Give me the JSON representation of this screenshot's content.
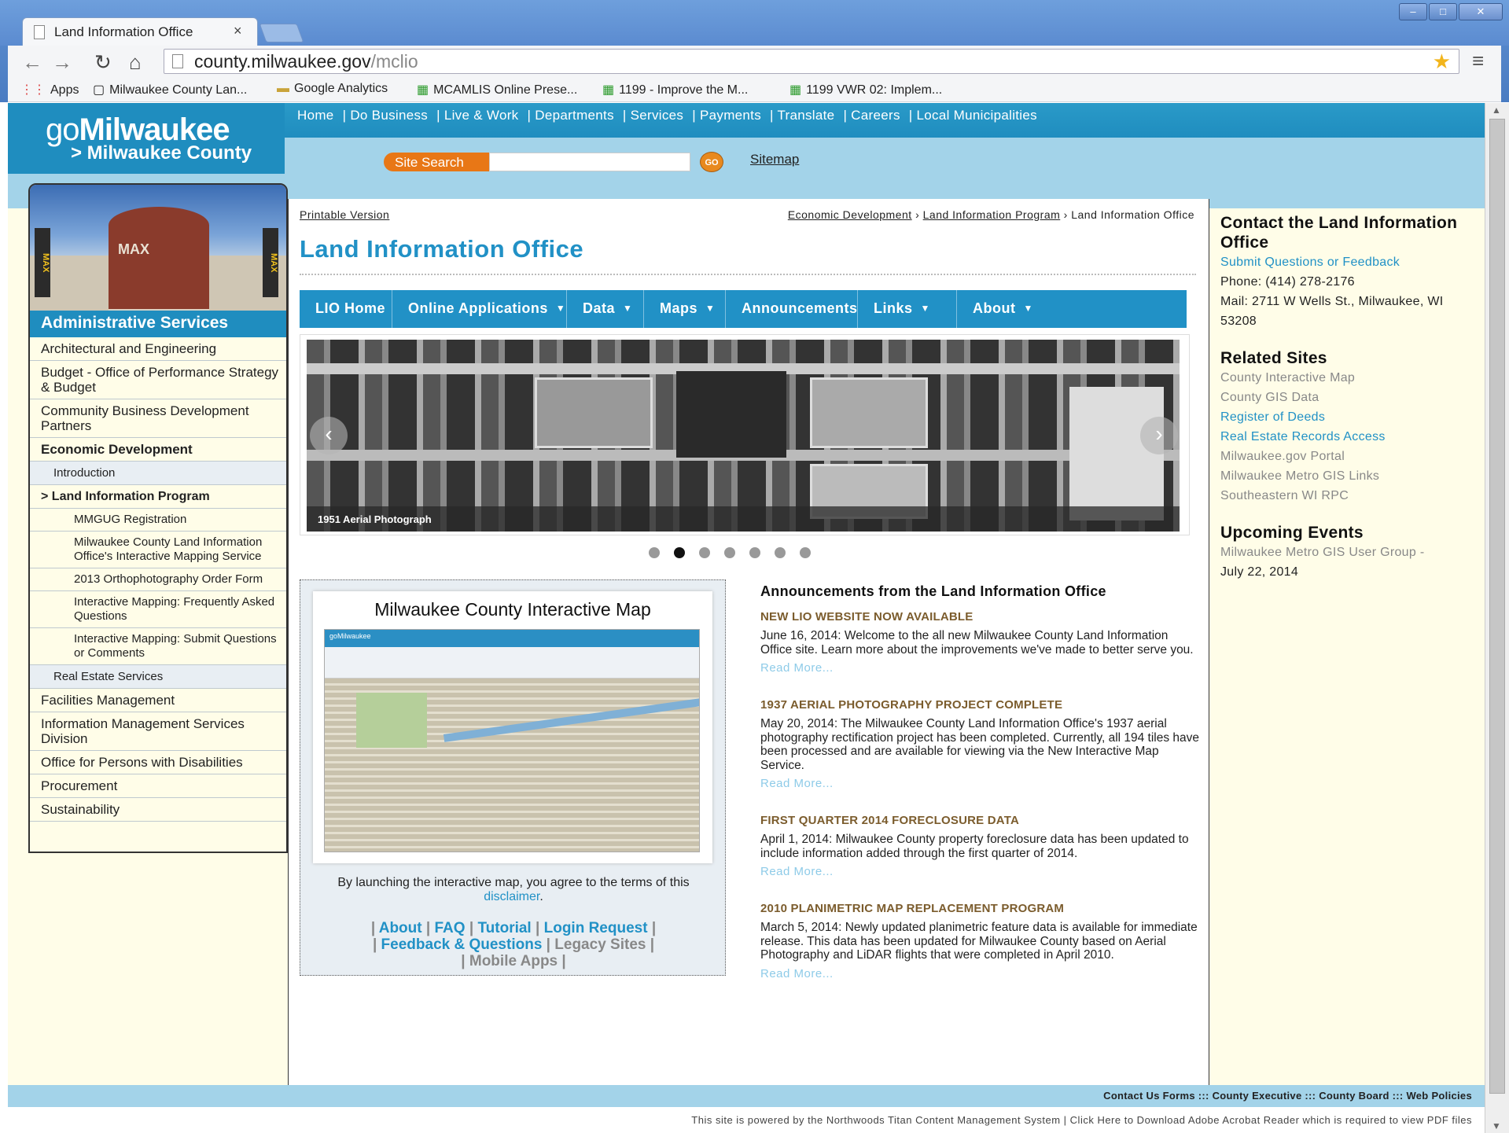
{
  "browser": {
    "tab_title": "Land Information Office",
    "tab_close": "×",
    "url_host": "county.milwaukee.gov",
    "url_path": "/mclio",
    "bookmarks": [
      "Apps",
      "Milwaukee County Lan...",
      "Google Analytics",
      "MCAMLIS Online Prese...",
      "1199 - Improve the M...",
      "1199 VWR 02: Implem..."
    ]
  },
  "header": {
    "logo_go": "go",
    "logo_main": "Milwaukee",
    "logo_sub": "> Milwaukee County",
    "topnav": [
      "Home",
      "| Do Business",
      "| Live & Work",
      "| Departments",
      "| Services",
      "| Payments",
      "| Translate",
      "| Careers",
      "| Local Municipalities"
    ],
    "site_search_label": "Site Search",
    "go_label": "GO",
    "sitemap_label": "Sitemap"
  },
  "leftnav": {
    "photo_text": "MAX",
    "heading": "Administrative Services",
    "items": [
      {
        "label": "Architectural and Engineering",
        "kind": "top"
      },
      {
        "label": "Budget - Office of Performance Strategy & Budget",
        "kind": "top"
      },
      {
        "label": "Community Business Development Partners",
        "kind": "top"
      },
      {
        "label": "Economic Development",
        "kind": "bold"
      },
      {
        "label": "Introduction",
        "kind": "sub"
      },
      {
        "label": "> Land Information Program",
        "kind": "subb"
      },
      {
        "label": "MMGUG Registration",
        "kind": "sub2"
      },
      {
        "label": "Milwaukee County Land Information Office's Interactive Mapping Service",
        "kind": "sub2"
      },
      {
        "label": "2013 Orthophotography Order Form",
        "kind": "sub2"
      },
      {
        "label": "Interactive Mapping: Frequently Asked Questions",
        "kind": "sub2"
      },
      {
        "label": "Interactive Mapping: Submit Questions or Comments",
        "kind": "sub2"
      },
      {
        "label": "Real Estate Services",
        "kind": "sub"
      },
      {
        "label": "Facilities Management",
        "kind": "top"
      },
      {
        "label": "Information Management Services Division",
        "kind": "top"
      },
      {
        "label": "Office for Persons with Disabilities",
        "kind": "top"
      },
      {
        "label": "Procurement",
        "kind": "top"
      },
      {
        "label": "Sustainability",
        "kind": "top"
      }
    ]
  },
  "main": {
    "printable": "Printable Version",
    "crumb1": "Economic Development",
    "crumb2": "Land Information Program",
    "crumb3": "Land Information Office",
    "crumb_sep": "›",
    "title": "Land Information Office",
    "menu": [
      "LIO Home",
      "Online Applications",
      "Data",
      "Maps",
      "Announcements",
      "Links",
      "About"
    ],
    "menu_caret": "▼",
    "slide_caption": "1951 Aerial Photograph",
    "prev_arrow": "‹",
    "next_arrow": "›",
    "slide_count": 7,
    "slide_active": 2
  },
  "mapbox": {
    "title": "Milwaukee County Interactive Map",
    "shot_header": "goMilwaukee",
    "text_before": "By launching the interactive map, you agree to the terms of this ",
    "disclaimer": "disclaimer",
    "text_after": ".",
    "links": [
      "About",
      "FAQ",
      "Tutorial",
      "Login Request",
      "Feedback & Questions",
      "Legacy Sites",
      "Mobile Apps"
    ],
    "sep": "|"
  },
  "announcements": {
    "heading": "Announcements from the Land Information Office",
    "items": [
      {
        "title": "NEW LIO WEBSITE NOW AVAILABLE",
        "body": "June 16, 2014: Welcome to the all new Milwaukee County Land Information Office site. Learn more about the improvements we've made to better serve you.",
        "more": "Read More..."
      },
      {
        "title": "1937 AERIAL PHOTOGRAPHY PROJECT COMPLETE",
        "body": "May 20, 2014: The Milwaukee County Land Information Office's 1937 aerial photography rectification project has been completed. Currently, all 194 tiles have been processed and are available for viewing via the New Interactive Map Service.",
        "more": "Read More..."
      },
      {
        "title": "FIRST QUARTER 2014 FORECLOSURE DATA",
        "body": "April 1, 2014: Milwaukee County property foreclosure data has been updated to include information added through the first quarter of 2014.",
        "more": "Read More..."
      },
      {
        "title": "2010 PLANIMETRIC MAP REPLACEMENT PROGRAM",
        "body": "March 5, 2014: Newly updated planimetric feature data is available for immediate release. This data has been updated for Milwaukee County based on Aerial Photography and LiDAR flights that were completed in April 2010.",
        "more": "Read More..."
      }
    ]
  },
  "right": {
    "contact_heading": "Contact the Land Information Office",
    "contact_link": "Submit Questions or Feedback",
    "phone": "Phone: (414) 278-2176",
    "mail": "Mail: 2711 W Wells St., Milwaukee, WI 53208",
    "related_heading": "Related Sites",
    "related": [
      {
        "label": "County Interactive Map",
        "style": "gray"
      },
      {
        "label": "County GIS Data",
        "style": "gray"
      },
      {
        "label": "Register of Deeds",
        "style": "link"
      },
      {
        "label": "Real Estate Records Access",
        "style": "link"
      },
      {
        "label": "Milwaukee.gov Portal",
        "style": "gray"
      },
      {
        "label": "Milwaukee Metro GIS Links",
        "style": "gray"
      },
      {
        "label": "Southeastern WI RPC",
        "style": "gray"
      }
    ],
    "events_heading": "Upcoming Events",
    "event_name": "Milwaukee Metro GIS User Group -",
    "event_date": "July 22, 2014"
  },
  "footer": {
    "links": "Contact Us Forms ::: County Executive ::: County Board ::: Web Policies",
    "note": "This site is powered by the Northwoods Titan Content Management System | Click Here to Download Adobe Acrobat Reader which is required to view PDF files"
  },
  "colors": {
    "accent": "#2191c6",
    "header_light": "#a3d3e9",
    "orange": "#e87716",
    "announce_title": "#7b5c2d"
  }
}
